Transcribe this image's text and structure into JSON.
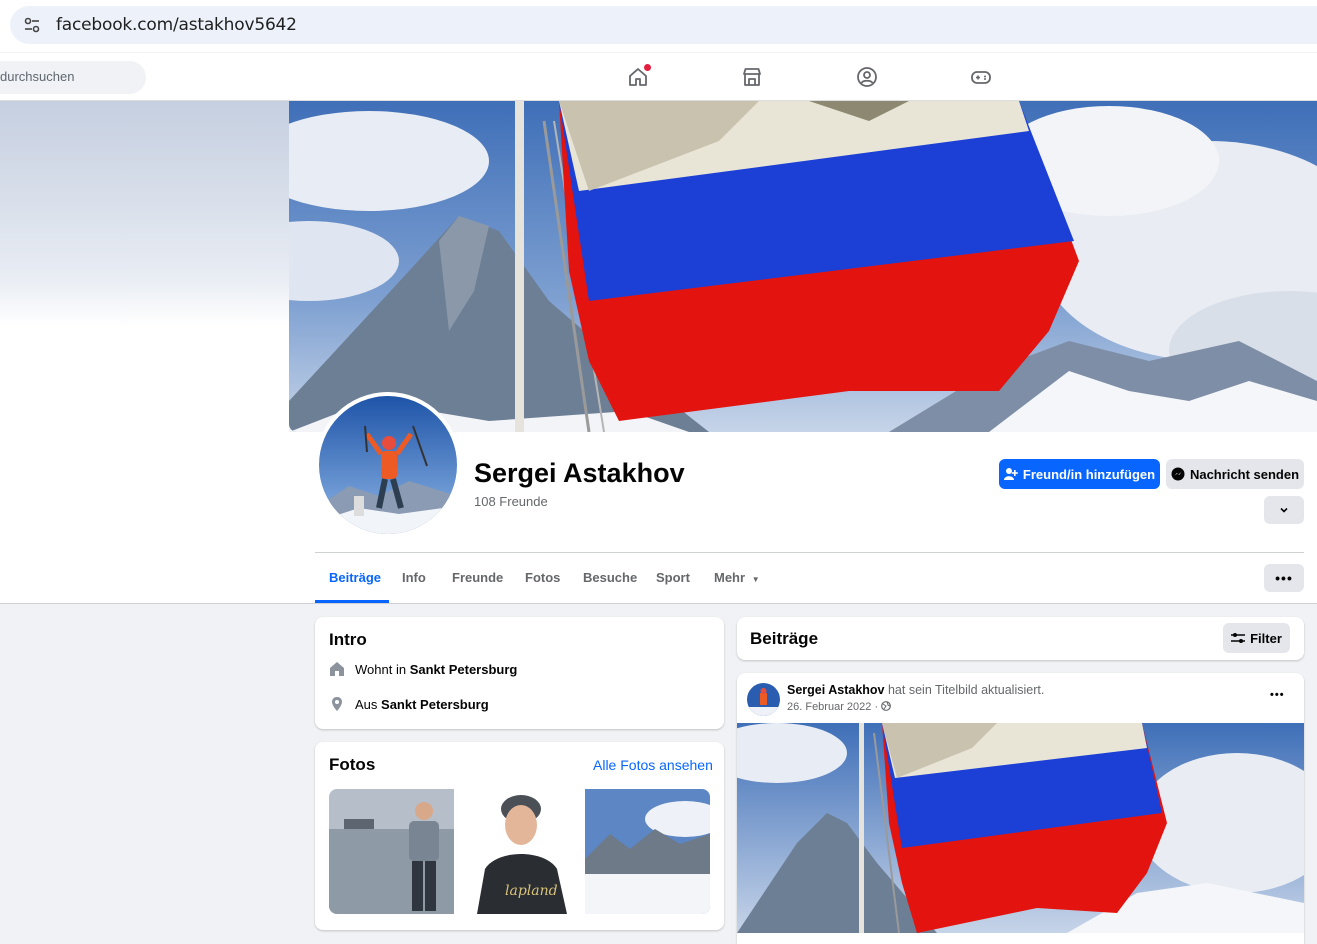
{
  "browser": {
    "url": "facebook.com/astakhov5642"
  },
  "header": {
    "search_placeholder": "durchsuchen"
  },
  "profile": {
    "name": "Sergei Astakhov",
    "friends_count": "108 Freunde",
    "add_friend_label": "Freund/in hinzufügen",
    "message_label": "Nachricht senden"
  },
  "tabs": [
    "Beiträge",
    "Info",
    "Freunde",
    "Fotos",
    "Besuche",
    "Sport",
    "Mehr"
  ],
  "intro": {
    "title": "Intro",
    "lives_prefix": "Wohnt in",
    "lives_city": "Sankt Petersburg",
    "from_prefix": "Aus",
    "from_city": "Sankt Petersburg"
  },
  "photos": {
    "title": "Fotos",
    "all_link": "Alle Fotos ansehen"
  },
  "posts": {
    "title": "Beiträge",
    "filter_label": "Filter",
    "post": {
      "author": "Sergei Astakhov",
      "action": "hat sein Titelbild aktualisiert.",
      "date": "26. Februar 2022"
    }
  },
  "colors": {
    "brand_blue": "#0866ff",
    "flag_white": "#e8e4d6",
    "flag_blue": "#1c3fd6",
    "flag_red": "#e3140f"
  }
}
